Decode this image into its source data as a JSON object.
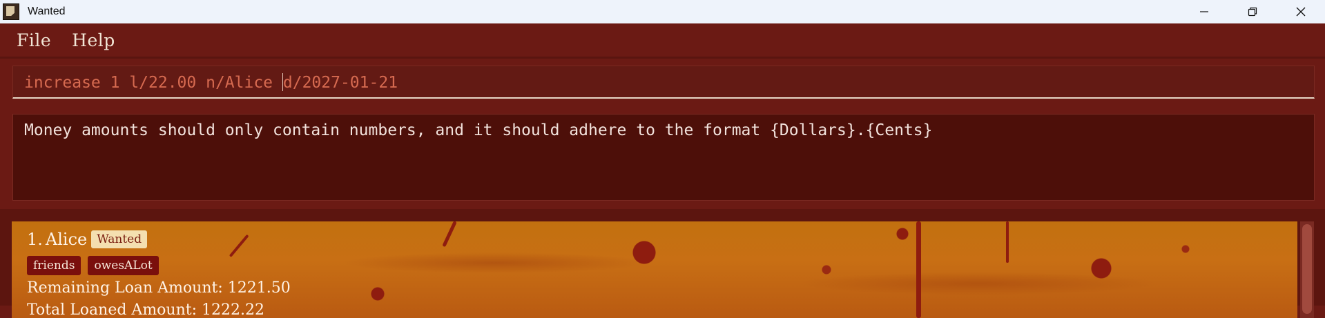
{
  "window": {
    "title": "Wanted"
  },
  "menu": {
    "items": [
      "File",
      "Help"
    ]
  },
  "command": {
    "before_caret": "increase 1 l/22.00 n/Alice ",
    "after_caret": "d/2027-01-21"
  },
  "result": {
    "message": "Money amounts should only contain numbers, and it should adhere to the format {Dollars}.{Cents}"
  },
  "persons": [
    {
      "index": "1.",
      "name": "Alice",
      "status": "Wanted",
      "tags": [
        "friends",
        "owesALot"
      ],
      "remaining_loan": "Remaining Loan Amount: 1221.50",
      "total_loaned_partial": "Total Loaned Amount: 1222.22"
    }
  ],
  "colors": {
    "background": "#6b1a14",
    "command_text": "#d66a50",
    "result_bg": "#4d0f09",
    "card_bg": "#c2700f",
    "status_tag_bg": "#f4dfb0",
    "tag_bg": "#7a0f0c"
  }
}
